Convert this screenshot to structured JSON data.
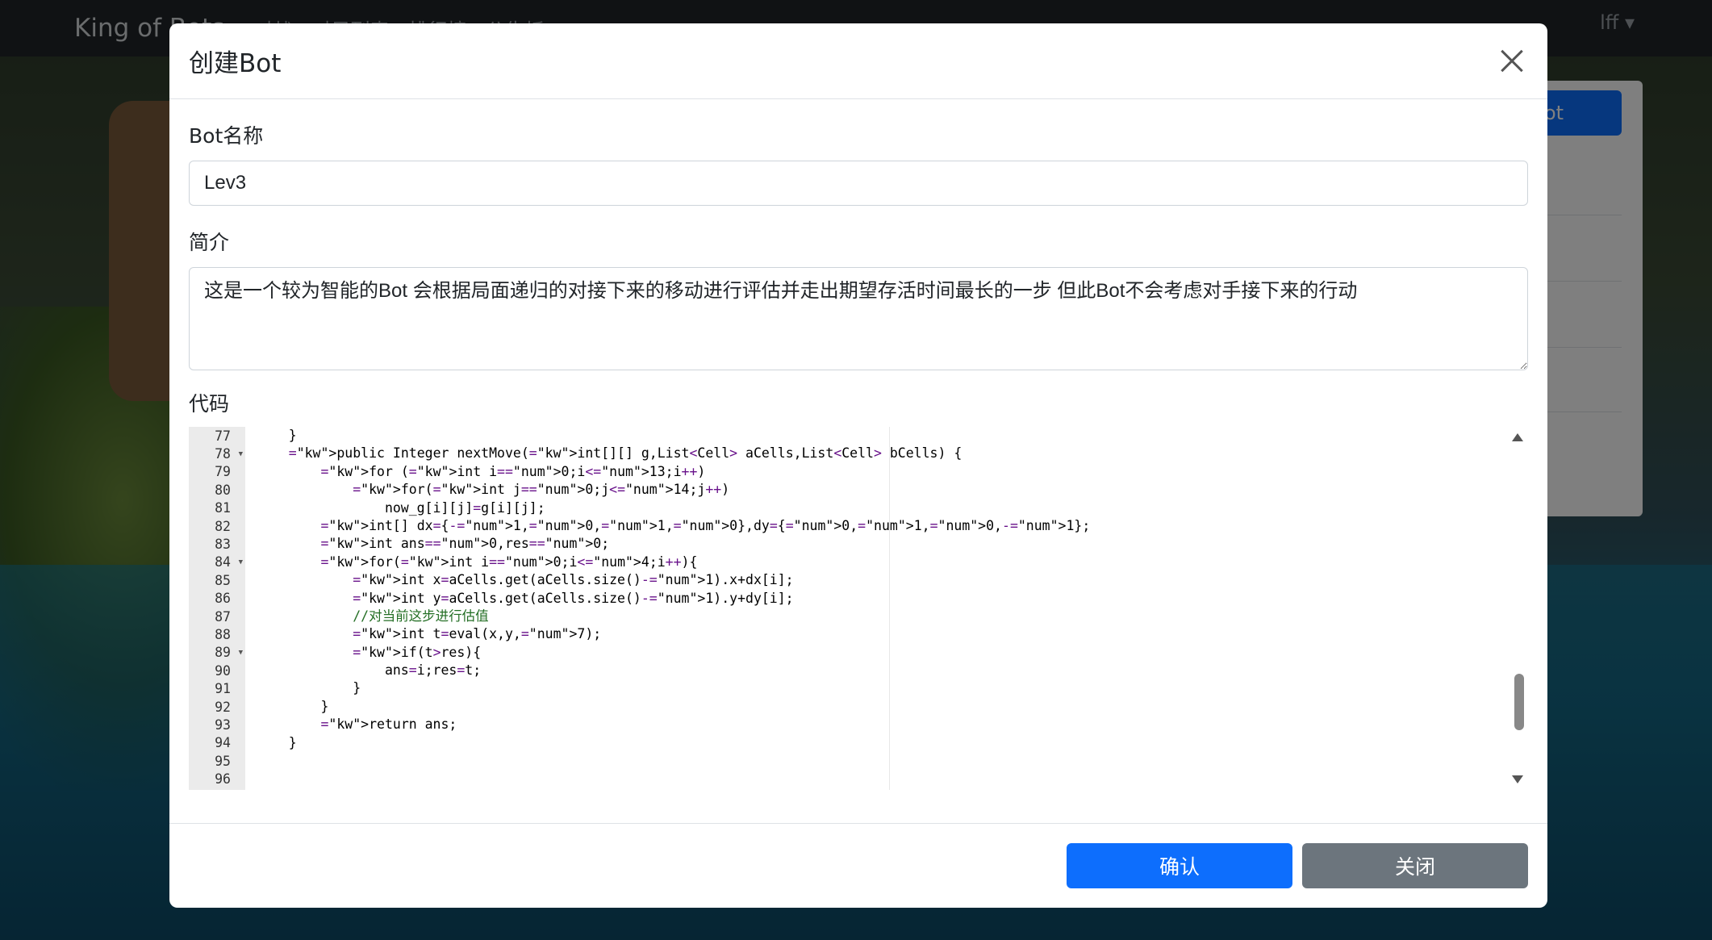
{
  "navbar": {
    "brand": "King of Bots",
    "links": [
      "对战",
      "对局列表",
      "排行榜",
      "公告板"
    ],
    "user": "lff"
  },
  "background": {
    "right_card_button": "ot"
  },
  "modal": {
    "title": "创建Bot",
    "fields": {
      "name_label": "Bot名称",
      "name_value": "Lev3",
      "desc_label": "简介",
      "desc_value": "这是一个较为智能的Bot 会根据局面递归的对接下来的移动进行评估并走出期望存活时间最长的一步 但此Bot不会考虑对手接下来的行动",
      "code_label": "代码"
    },
    "editor": {
      "lines": [
        {
          "n": "77",
          "fold": false
        },
        {
          "n": "78",
          "fold": true
        },
        {
          "n": "79",
          "fold": false
        },
        {
          "n": "80",
          "fold": false
        },
        {
          "n": "81",
          "fold": false
        },
        {
          "n": "82",
          "fold": false
        },
        {
          "n": "83",
          "fold": false
        },
        {
          "n": "84",
          "fold": true
        },
        {
          "n": "85",
          "fold": false
        },
        {
          "n": "86",
          "fold": false
        },
        {
          "n": "87",
          "fold": false
        },
        {
          "n": "88",
          "fold": false
        },
        {
          "n": "89",
          "fold": true
        },
        {
          "n": "90",
          "fold": false
        },
        {
          "n": "91",
          "fold": false
        },
        {
          "n": "92",
          "fold": false
        },
        {
          "n": "93",
          "fold": false
        },
        {
          "n": "94",
          "fold": false
        },
        {
          "n": "95",
          "fold": false
        },
        {
          "n": "96",
          "fold": false
        }
      ],
      "code": [
        "    }",
        "    public Integer nextMove(int[][] g,List<Cell> aCells,List<Cell> bCells) {",
        "        for (int i=0;i<13;i++)",
        "            for(int j=0;j<14;j++)",
        "                now_g[i][j]=g[i][j];",
        "        int[] dx={-1,0,1,0},dy={0,1,0,-1};",
        "        int ans=0,res=0;",
        "        for(int i=0;i<4;i++){",
        "            int x=aCells.get(aCells.size()-1).x+dx[i];",
        "            int y=aCells.get(aCells.size()-1).y+dy[i];",
        "            //对当前这步进行估值",
        "            int t=eval(x,y,7);",
        "            if(t>res){",
        "                ans=i;res=t;",
        "            }",
        "        }",
        "        return ans;",
        "    }",
        "",
        ""
      ]
    },
    "buttons": {
      "confirm": "确认",
      "close": "关闭"
    }
  }
}
